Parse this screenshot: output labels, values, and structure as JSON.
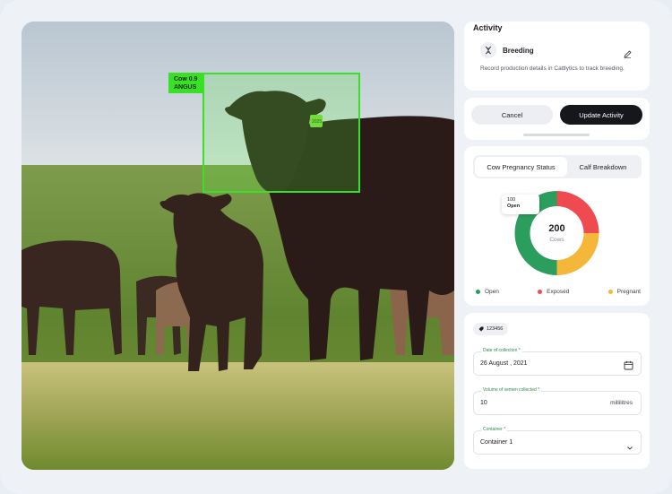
{
  "photo": {
    "detection_label_line1": "Cow 0.9",
    "detection_label_line2": "ANGUS",
    "ear_tag": "2025"
  },
  "activity": {
    "title": "Activity",
    "item_label": "Breeding",
    "item_icon": "dna-icon",
    "description": "Record production details in Cattlytics to track breeding."
  },
  "actions": {
    "cancel_label": "Cancel",
    "update_label": "Update Activity"
  },
  "pregnancy": {
    "tabs": [
      {
        "label": "Cow Pregnancy Status",
        "active": true
      },
      {
        "label": "Calf Breakdown",
        "active": false
      }
    ],
    "tooltip_value": "100",
    "tooltip_label": "Open",
    "center_value": "200",
    "center_label": "Cows",
    "legend": [
      {
        "label": "Open",
        "color": "#2b9d5c"
      },
      {
        "label": "Exposed",
        "color": "#ef4a4f"
      },
      {
        "label": "Pregnant",
        "color": "#f4b73a"
      }
    ]
  },
  "chart_data": {
    "type": "pie",
    "categories": [
      "Open",
      "Exposed",
      "Pregnant"
    ],
    "values": [
      100,
      50,
      50
    ],
    "colors": [
      "#2b9d5c",
      "#ef4a4f",
      "#f4b73a"
    ],
    "total": 200
  },
  "form": {
    "tag_chip": "123456",
    "date_label": "Date of collection *",
    "date_value": "26 August , 2021",
    "volume_label": "Volume of semen collected *",
    "volume_value": "10",
    "volume_unit": "millilitres",
    "container_label": "Container *",
    "container_value": "Container 1"
  }
}
